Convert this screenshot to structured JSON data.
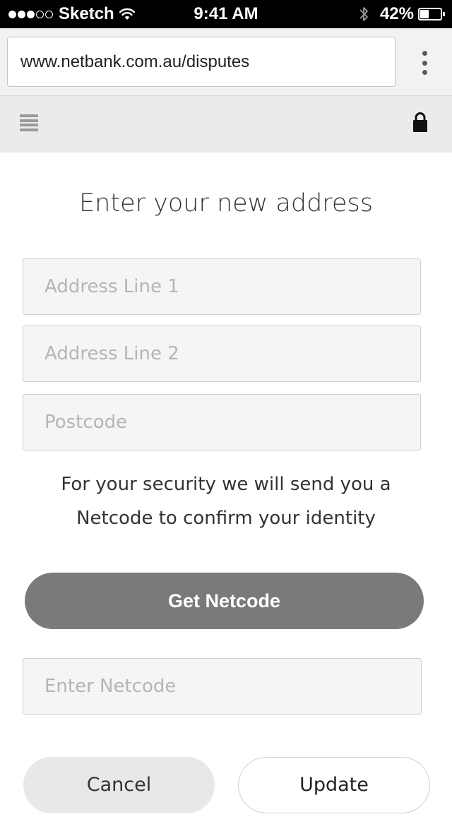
{
  "status_bar": {
    "signal_dots_filled": 3,
    "signal_dots_total": 5,
    "carrier": "Sketch",
    "time": "9:41 AM",
    "battery_percent": "42%",
    "battery_level": 0.42,
    "icons": [
      "wifi-icon",
      "bluetooth-icon",
      "battery-icon"
    ]
  },
  "browser": {
    "url": "www.netbank.com.au/disputes",
    "menu_icon": "more-vertical-icon"
  },
  "site_header": {
    "menu_icon": "hamburger-menu-icon",
    "lock_icon": "lock-icon"
  },
  "form": {
    "title": "Enter your new address",
    "address_line_1": {
      "value": "",
      "placeholder": "Address Line 1"
    },
    "address_line_2": {
      "value": "",
      "placeholder": "Address Line 2"
    },
    "postcode": {
      "value": "",
      "placeholder": "Postcode"
    },
    "security_line_1": "For your security we will send you a",
    "security_line_2": "Netcode to confirm your identity",
    "get_netcode_label": "Get Netcode",
    "netcode": {
      "value": "",
      "placeholder": "Enter Netcode"
    },
    "cancel_label": "Cancel",
    "update_label": "Update"
  },
  "colors": {
    "status_bar_bg": "#000000",
    "browser_bar_bg": "#f2f2f2",
    "site_header_bg": "#ebebeb",
    "primary_button_bg": "#7a7a7a",
    "secondary_button_bg": "#e7e9e9",
    "field_bg": "#f5f5f5"
  }
}
